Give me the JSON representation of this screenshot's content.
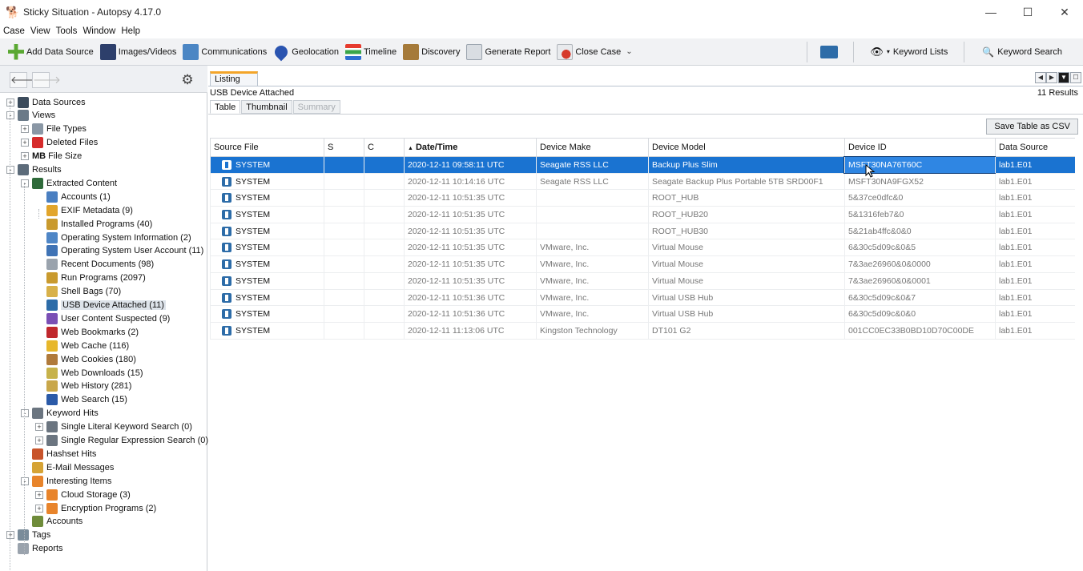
{
  "window": {
    "title": "Sticky Situation - Autopsy 4.17.0",
    "minimize": "—",
    "maximize": "☐",
    "close": "✕"
  },
  "menu": [
    "Case",
    "View",
    "Tools",
    "Window",
    "Help"
  ],
  "toolbar": {
    "add_data_source": "Add Data Source",
    "images_videos": "Images/Videos",
    "communications": "Communications",
    "geolocation": "Geolocation",
    "timeline": "Timeline",
    "discovery": "Discovery",
    "generate_report": "Generate Report",
    "close_case": "Close Case",
    "keyword_lists": "Keyword Lists",
    "keyword_search": "Keyword Search"
  },
  "tree": [
    {
      "label": "Data Sources",
      "level": 0,
      "expander": "+",
      "icon": "disk-icon",
      "color": "#3b4b5c"
    },
    {
      "label": "Views",
      "level": 0,
      "expander": "-",
      "icon": "eye-icon",
      "color": "#6b7a88"
    },
    {
      "label": "File Types",
      "level": 1,
      "expander": "+",
      "icon": "folder-icon",
      "color": "#8a97a5"
    },
    {
      "label": "Deleted Files",
      "level": 1,
      "expander": "+",
      "icon": "deleted-icon",
      "color": "#d62b2b"
    },
    {
      "label": "File Size",
      "level": 1,
      "expander": "+",
      "icon": "mb-icon",
      "color": "#111111",
      "prefix": "MB"
    },
    {
      "label": "Results",
      "level": 0,
      "expander": "-",
      "icon": "results-icon",
      "color": "#5c6b7a"
    },
    {
      "label": "Extracted Content",
      "level": 1,
      "expander": "-",
      "icon": "extracted-icon",
      "color": "#2f6a3a"
    },
    {
      "label": "Accounts (1)",
      "level": 2,
      "icon": "accounts-icon",
      "color": "#4a7fc1"
    },
    {
      "label": "EXIF Metadata (9)",
      "level": 2,
      "icon": "exif-icon",
      "color": "#e2a52b"
    },
    {
      "label": "Installed Programs (40)",
      "level": 2,
      "icon": "installed-icon",
      "color": "#c99a2e"
    },
    {
      "label": "Operating System Information (2)",
      "level": 2,
      "icon": "os-info-icon",
      "color": "#4f86c6"
    },
    {
      "label": "Operating System User Account (11)",
      "level": 2,
      "icon": "os-user-icon",
      "color": "#3f73b5"
    },
    {
      "label": "Recent Documents (98)",
      "level": 2,
      "icon": "recent-docs-icon",
      "color": "#9aa3ad"
    },
    {
      "label": "Run Programs (2097)",
      "level": 2,
      "icon": "run-programs-icon",
      "color": "#c99a2e"
    },
    {
      "label": "Shell Bags (70)",
      "level": 2,
      "icon": "shellbags-icon",
      "color": "#d8b14a"
    },
    {
      "label": "USB Device Attached (11)",
      "level": 2,
      "icon": "usb-icon",
      "color": "#2d6ca8",
      "selected": true
    },
    {
      "label": "User Content Suspected (9)",
      "level": 2,
      "icon": "user-content-icon",
      "color": "#7a4fb5"
    },
    {
      "label": "Web Bookmarks (2)",
      "level": 2,
      "icon": "bookmark-icon",
      "color": "#c0282d"
    },
    {
      "label": "Web Cache (116)",
      "level": 2,
      "icon": "cache-icon",
      "color": "#e7b72b"
    },
    {
      "label": "Web Cookies (180)",
      "level": 2,
      "icon": "cookie-icon",
      "color": "#b07a3b"
    },
    {
      "label": "Web Downloads (15)",
      "level": 2,
      "icon": "download-icon",
      "color": "#c7b24a"
    },
    {
      "label": "Web History (281)",
      "level": 2,
      "icon": "history-icon",
      "color": "#c9a74a"
    },
    {
      "label": "Web Search (15)",
      "level": 2,
      "icon": "globe-icon",
      "color": "#2b5aa8"
    },
    {
      "label": "Keyword Hits",
      "level": 1,
      "expander": "-",
      "icon": "keyword-icon",
      "color": "#6b7580"
    },
    {
      "label": "Single Literal Keyword Search (0)",
      "level": 2,
      "expander": "+",
      "icon": "search-icon",
      "color": "#6b7580"
    },
    {
      "label": "Single Regular Expression Search (0)",
      "level": 2,
      "expander": "+",
      "icon": "search-icon",
      "color": "#6b7580"
    },
    {
      "label": "Hashset Hits",
      "level": 1,
      "icon": "hashset-icon",
      "color": "#c8542b"
    },
    {
      "label": "E-Mail Messages",
      "level": 1,
      "icon": "email-icon",
      "color": "#d6a335"
    },
    {
      "label": "Interesting Items",
      "level": 1,
      "expander": "-",
      "icon": "interesting-icon",
      "color": "#e8842b"
    },
    {
      "label": "Cloud Storage (3)",
      "level": 2,
      "expander": "+",
      "icon": "interesting-icon",
      "color": "#e8842b"
    },
    {
      "label": "Encryption Programs (2)",
      "level": 2,
      "expander": "+",
      "icon": "interesting-icon",
      "color": "#e8842b"
    },
    {
      "label": "Accounts",
      "level": 1,
      "icon": "accounts-group-icon",
      "color": "#6f8c3a"
    },
    {
      "label": "Tags",
      "level": 0,
      "expander": "+",
      "icon": "tag-icon",
      "color": "#7a8c9a"
    },
    {
      "label": "Reports",
      "level": 0,
      "icon": "report-icon",
      "color": "#9aa3ad"
    }
  ],
  "listing": {
    "tab": "Listing",
    "title": "USB Device Attached",
    "count": "11 Results",
    "subtabs": [
      "Table",
      "Thumbnail",
      "Summary"
    ],
    "save_csv": "Save Table as CSV"
  },
  "table": {
    "columns": [
      "Source File",
      "S",
      "C",
      "Date/Time",
      "Device Make",
      "Device Model",
      "Device ID",
      "Data Source"
    ],
    "sort_indicator": "▲",
    "rows": [
      [
        "SYSTEM",
        "",
        "",
        "2020-12-11 09:58:11 UTC",
        "Seagate RSS LLC",
        "Backup Plus Slim",
        "MSFT30NA76T60C",
        "lab1.E01"
      ],
      [
        "SYSTEM",
        "",
        "",
        "2020-12-11 10:14:16 UTC",
        "Seagate RSS LLC",
        "Seagate Backup Plus Portable 5TB SRD00F1",
        "MSFT30NA9FGX52",
        "lab1.E01"
      ],
      [
        "SYSTEM",
        "",
        "",
        "2020-12-11 10:51:35 UTC",
        "",
        "ROOT_HUB",
        "5&37ce0dfc&0",
        "lab1.E01"
      ],
      [
        "SYSTEM",
        "",
        "",
        "2020-12-11 10:51:35 UTC",
        "",
        "ROOT_HUB20",
        "5&1316feb7&0",
        "lab1.E01"
      ],
      [
        "SYSTEM",
        "",
        "",
        "2020-12-11 10:51:35 UTC",
        "",
        "ROOT_HUB30",
        "5&21ab4ffc&0&0",
        "lab1.E01"
      ],
      [
        "SYSTEM",
        "",
        "",
        "2020-12-11 10:51:35 UTC",
        "VMware, Inc.",
        "Virtual Mouse",
        "6&30c5d09c&0&5",
        "lab1.E01"
      ],
      [
        "SYSTEM",
        "",
        "",
        "2020-12-11 10:51:35 UTC",
        "VMware, Inc.",
        "Virtual Mouse",
        "7&3ae26960&0&0000",
        "lab1.E01"
      ],
      [
        "SYSTEM",
        "",
        "",
        "2020-12-11 10:51:35 UTC",
        "VMware, Inc.",
        "Virtual Mouse",
        "7&3ae26960&0&0001",
        "lab1.E01"
      ],
      [
        "SYSTEM",
        "",
        "",
        "2020-12-11 10:51:36 UTC",
        "VMware, Inc.",
        "Virtual USB Hub",
        "6&30c5d09c&0&7",
        "lab1.E01"
      ],
      [
        "SYSTEM",
        "",
        "",
        "2020-12-11 10:51:36 UTC",
        "VMware, Inc.",
        "Virtual USB Hub",
        "6&30c5d09c&0&0",
        "lab1.E01"
      ],
      [
        "SYSTEM",
        "",
        "",
        "2020-12-11 11:13:06 UTC",
        "Kingston Technology",
        "DT101 G2",
        "001CC0EC33B0BD10D70C00DE",
        "lab1.E01"
      ]
    ],
    "selected_row": 0
  }
}
